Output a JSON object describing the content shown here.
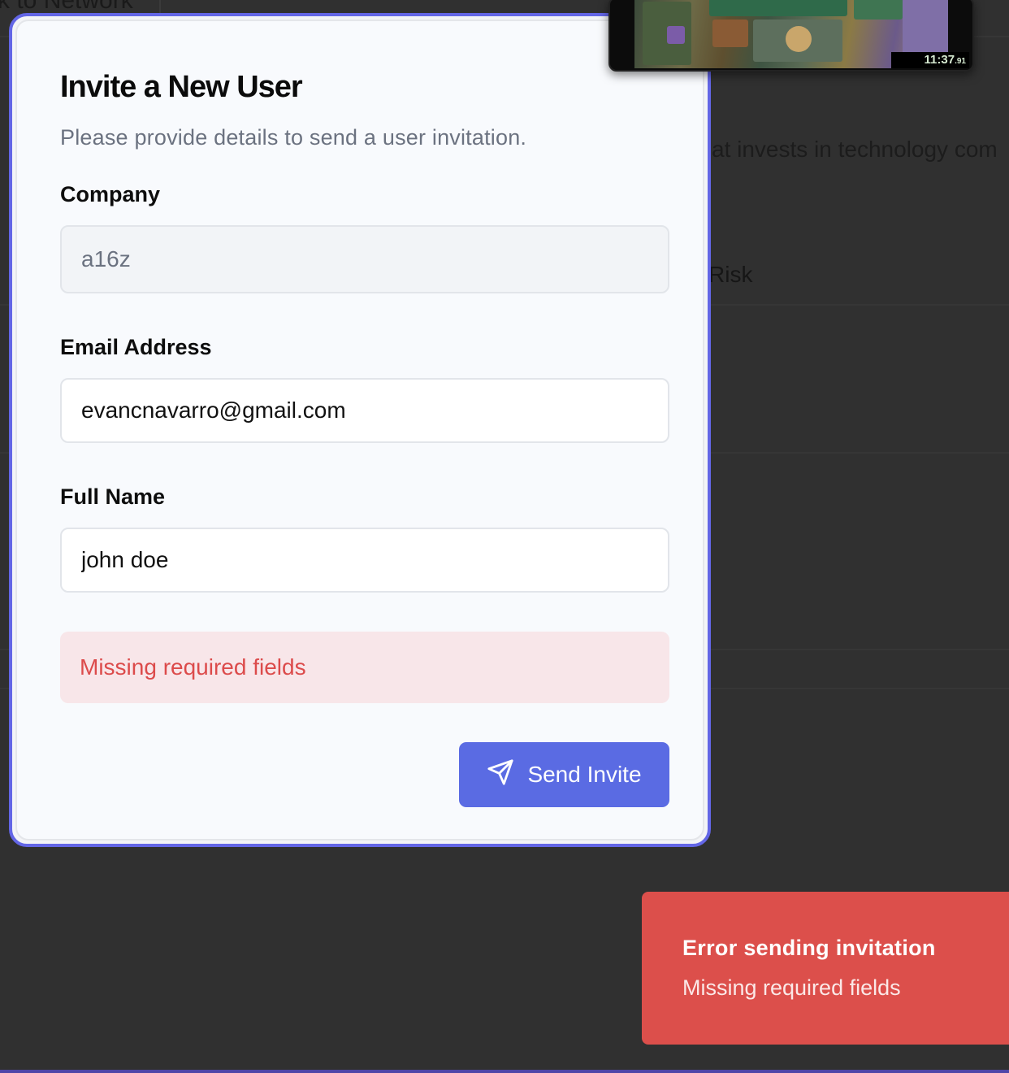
{
  "background": {
    "back_link": "ck to Network",
    "description_fragment": "at invests in technology com",
    "column_header_fragment": "Risk"
  },
  "modal": {
    "title": "Invite a New User",
    "subtitle": "Please provide details to send a user invitation.",
    "company": {
      "label": "Company",
      "value": "a16z"
    },
    "email": {
      "label": "Email Address",
      "value": "evancnavarro@gmail.com"
    },
    "full_name": {
      "label": "Full Name",
      "value": "john doe"
    },
    "error_message": "Missing required fields",
    "send_button": {
      "label": "Send Invite",
      "icon": "send-icon"
    }
  },
  "video_overlay": {
    "timer": "11:37",
    "timer_fraction": ".91"
  },
  "toast": {
    "title": "Error sending invitation",
    "message": "Missing required fields"
  },
  "colors": {
    "accent": "#5a6be3",
    "modal_border": "#6366e6",
    "error_text": "#dc4b4b",
    "error_bg": "#f8e6e9",
    "toast_bg": "#dc4f4b"
  }
}
